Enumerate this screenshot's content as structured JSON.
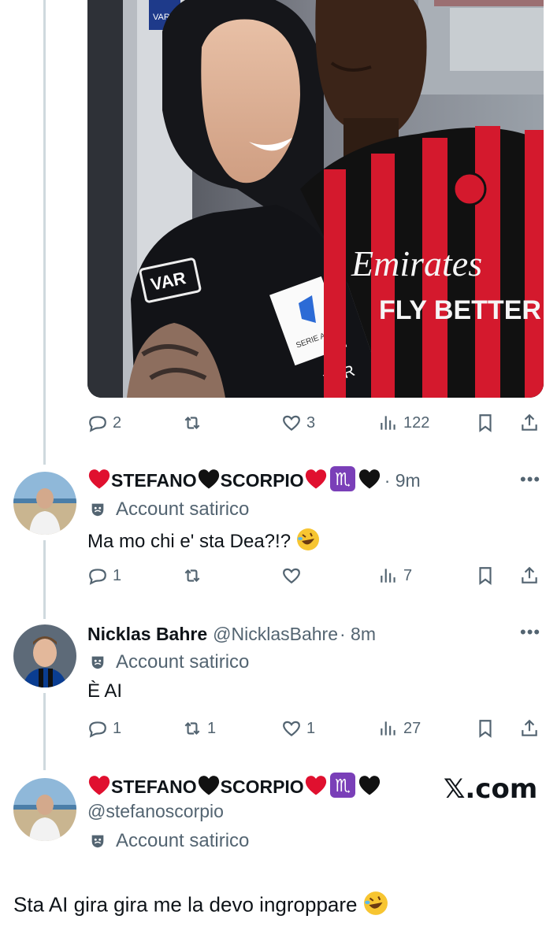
{
  "media": {
    "var_sign": "VAR Ro",
    "shirt_var": "VAR",
    "shirt_var_bottom": "VAR",
    "badge_serie": "SERIE A",
    "jersey_brand": "Emirates",
    "jersey_slogan": "FLY BETTER"
  },
  "post1_actions": {
    "reply": "2",
    "retweet": "",
    "like": "3",
    "views": "122"
  },
  "reply1": {
    "name_part1": "STEFANO",
    "name_part2": "SCORPIO",
    "time": "· 9m",
    "label": "Account satirico",
    "text": "Ma mo chi e' sta Dea?!?",
    "actions": {
      "reply": "1",
      "retweet": "",
      "like": "",
      "views": "7"
    }
  },
  "reply2": {
    "name": "Nicklas Bahre",
    "handle": "@NicklasBahre",
    "time": "· 8m",
    "label": "Account satirico",
    "text": "È AI",
    "actions": {
      "reply": "1",
      "retweet": "1",
      "like": "1",
      "views": "27"
    }
  },
  "reply3": {
    "name_part1": "STEFANO",
    "name_part2": "SCORPIO",
    "handle": "@stefanoscorpio",
    "label": "Account satirico",
    "text": "Sta AI gira gira me la devo ingroppare"
  },
  "watermark": "𝕏.com",
  "colors": {
    "text": "#0f1419",
    "muted": "#536471",
    "thread": "#cfd9de",
    "heart": "#e0102f",
    "scorpio": "#7a3fb8"
  }
}
